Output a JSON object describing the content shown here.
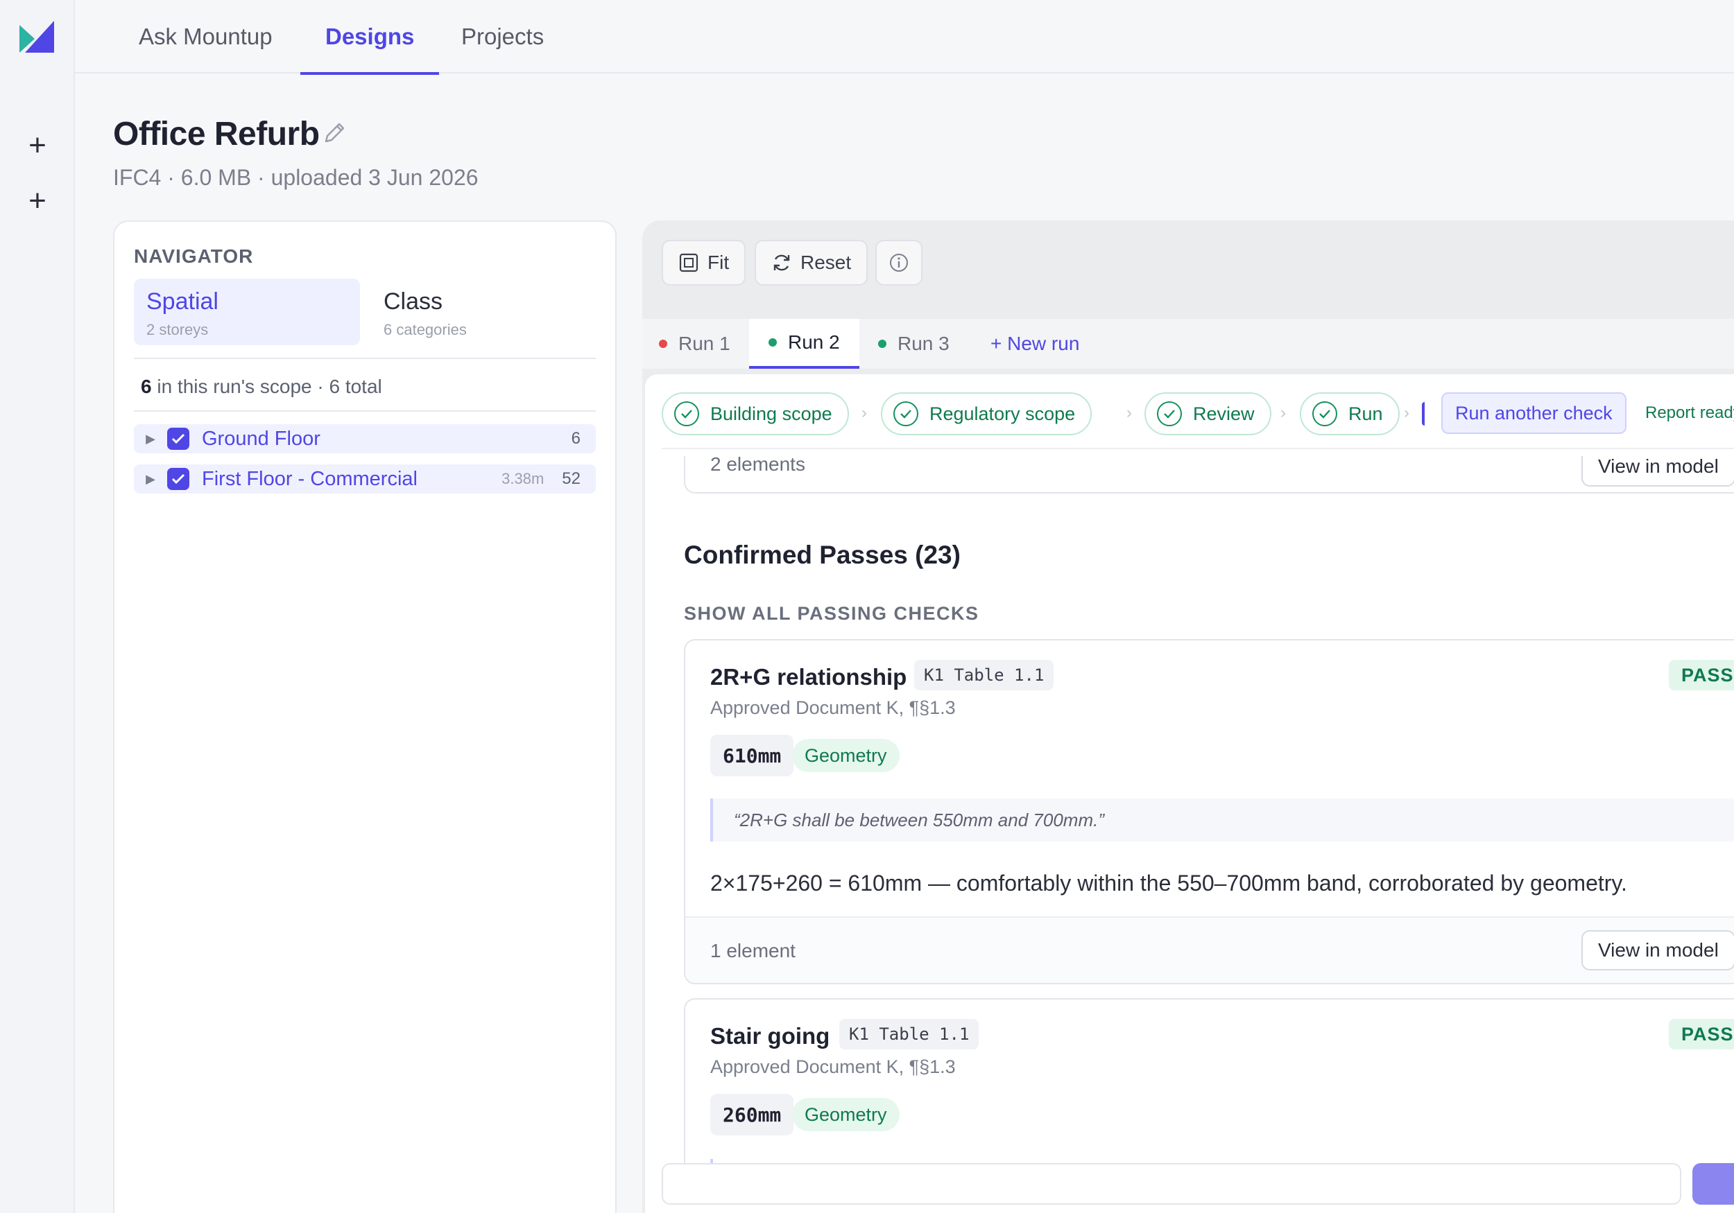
{
  "nav": {
    "tabs": [
      {
        "label": "Ask Mountup"
      },
      {
        "label": "Designs"
      },
      {
        "label": "Projects"
      }
    ]
  },
  "rail": {
    "add_icons": [
      "plus-icon",
      "plus-icon"
    ]
  },
  "page": {
    "title": "Office Refurb",
    "subtitle": "IFC4 · 6.0 MB · uploaded 3 Jun 2026"
  },
  "navigator": {
    "heading": "NAVIGATOR",
    "segments": [
      {
        "label": "Spatial",
        "sub": "2 storeys"
      },
      {
        "label": "Class",
        "sub": "6 categories"
      }
    ],
    "scope": {
      "count": "6",
      "rest": " in this run's scope · 6 total"
    },
    "tree": [
      {
        "label": "Ground Floor",
        "meta": "",
        "count": "6"
      },
      {
        "label": "First Floor - Commercial",
        "meta": "3.38m",
        "count": "52"
      }
    ]
  },
  "viewer": {
    "tools": {
      "fit": "Fit",
      "reset": "Reset"
    },
    "runs": [
      {
        "label": "Run 1",
        "color": "#e5484d"
      },
      {
        "label": "Run 2",
        "color": "#1aa06d"
      },
      {
        "label": "Run 3",
        "color": "#1aa06d"
      }
    ],
    "new_run": "+ New run"
  },
  "report": {
    "steps": [
      "Building scope",
      "Regulatory scope",
      "Review",
      "Run"
    ],
    "run_another": "Run another check",
    "report_ready": "Report ready",
    "prev_card": {
      "elements": "2 elements",
      "view": "View in model"
    },
    "section_title": "Confirmed Passes (23)",
    "section_sub": "SHOW ALL PASSING CHECKS",
    "checks": [
      {
        "title": "2R+G relationship",
        "code": "K1 Table 1.1",
        "badge": "PASS",
        "ref": "Approved Document K, ¶§1.3",
        "value": "610mm",
        "tag": "Geometry",
        "quote": "“2R+G shall be between 550mm and 700mm.”",
        "explain": "2×175+260 = 610mm — comfortably within the 550–700mm band, corroborated by geometry.",
        "elements": "1 element",
        "view": "View in model"
      },
      {
        "title": "Stair going",
        "code": "K1 Table 1.1",
        "badge": "PASS",
        "ref": "Approved Document K, ¶§1.3",
        "value": "260mm",
        "tag": "Geometry"
      }
    ]
  },
  "colors": {
    "accent": "#4f46e5",
    "pass": "#0f7a4f",
    "pass_bg": "#e3f6ec"
  }
}
